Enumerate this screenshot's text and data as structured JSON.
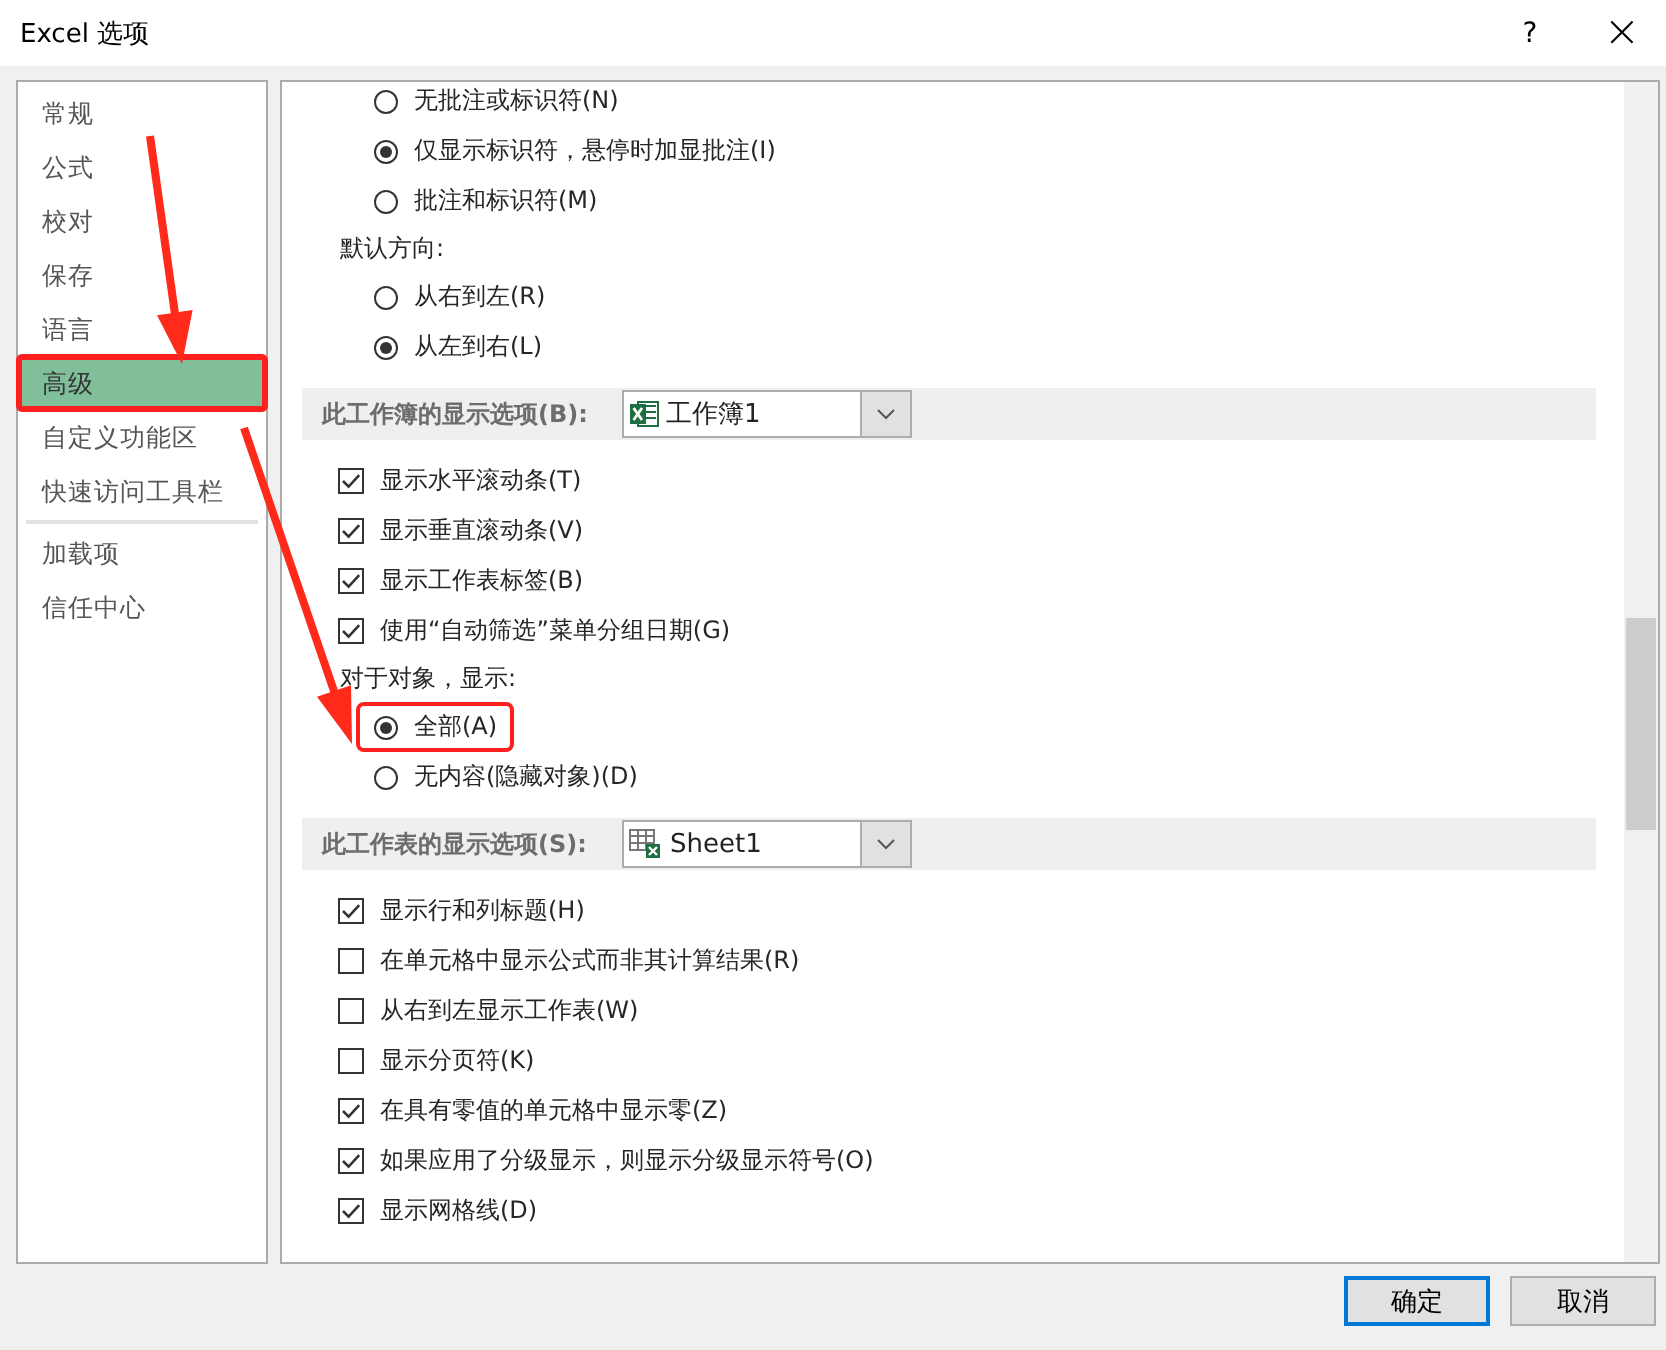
{
  "window": {
    "title": "Excel 选项",
    "help": "?",
    "close": "×"
  },
  "sidebar": {
    "items": [
      {
        "label": "常规",
        "selected": false,
        "highlighted": false
      },
      {
        "label": "公式",
        "selected": false,
        "highlighted": false
      },
      {
        "label": "校对",
        "selected": false,
        "highlighted": false
      },
      {
        "label": "保存",
        "selected": false,
        "highlighted": false
      },
      {
        "label": "语言",
        "selected": false,
        "highlighted": false
      },
      {
        "label": "高级",
        "selected": true,
        "highlighted": true
      },
      {
        "label": "自定义功能区",
        "selected": false,
        "highlighted": false
      },
      {
        "label": "快速访问工具栏",
        "selected": false,
        "highlighted": false,
        "divider_after": true
      },
      {
        "label": "加载项",
        "selected": false,
        "highlighted": false
      },
      {
        "label": "信任中心",
        "selected": false,
        "highlighted": false
      }
    ]
  },
  "options": [
    {
      "kind": "radio",
      "label": "无批注或标识符(N)",
      "selected": false,
      "highlighted": false
    },
    {
      "kind": "radio",
      "label": "仅显示标识符，悬停时加显批注(I)",
      "selected": true,
      "highlighted": false
    },
    {
      "kind": "radio",
      "label": "批注和标识符(M)",
      "selected": false,
      "highlighted": false
    },
    {
      "kind": "label",
      "label": "默认方向:"
    },
    {
      "kind": "radio",
      "label": "从右到左(R)",
      "selected": false,
      "highlighted": false
    },
    {
      "kind": "radio",
      "label": "从左到右(L)",
      "selected": true,
      "highlighted": false
    },
    {
      "kind": "workbook_header",
      "label": "此工作簿的显示选项(B):",
      "value": "工作簿1"
    },
    {
      "kind": "checkbox",
      "label": "显示水平滚动条(T)",
      "checked": true
    },
    {
      "kind": "checkbox",
      "label": "显示垂直滚动条(V)",
      "checked": true
    },
    {
      "kind": "checkbox",
      "label": "显示工作表标签(B)",
      "checked": true
    },
    {
      "kind": "checkbox",
      "label": "使用“自动筛选”菜单分组日期(G)",
      "checked": true
    },
    {
      "kind": "label",
      "label": "对于对象，显示:"
    },
    {
      "kind": "radio",
      "label": "全部(A)",
      "selected": true,
      "highlighted": true
    },
    {
      "kind": "radio",
      "label": "无内容(隐藏对象)(D)",
      "selected": false,
      "highlighted": false
    },
    {
      "kind": "sheet_header",
      "label": "此工作表的显示选项(S):",
      "value": "Sheet1"
    },
    {
      "kind": "checkbox",
      "label": "显示行和列标题(H)",
      "checked": true
    },
    {
      "kind": "checkbox",
      "label": "在单元格中显示公式而非其计算结果(R)",
      "checked": false
    },
    {
      "kind": "checkbox",
      "label": "从右到左显示工作表(W)",
      "checked": false
    },
    {
      "kind": "checkbox",
      "label": "显示分页符(K)",
      "checked": false
    },
    {
      "kind": "checkbox",
      "label": "在具有零值的单元格中显示零(Z)",
      "checked": true
    },
    {
      "kind": "checkbox",
      "label": "如果应用了分级显示，则显示分级显示符号(O)",
      "checked": true
    },
    {
      "kind": "checkbox",
      "label": "显示网格线(D)",
      "checked": true
    }
  ],
  "buttons": [
    {
      "label": "确定",
      "default": true
    },
    {
      "label": "取消",
      "default": false
    }
  ]
}
